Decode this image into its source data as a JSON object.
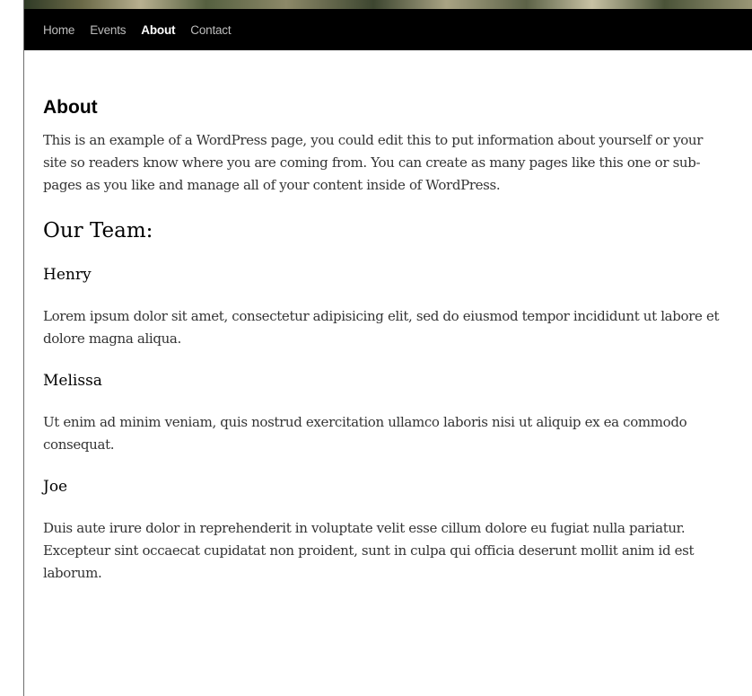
{
  "nav": {
    "items": [
      {
        "label": "Home",
        "active": false
      },
      {
        "label": "Events",
        "active": false
      },
      {
        "label": "About",
        "active": true
      },
      {
        "label": "Contact",
        "active": false
      }
    ]
  },
  "page": {
    "title": "About",
    "intro": "This is an example of a WordPress page, you could edit this to put information about yourself or your site so readers know where you are coming from. You can create as many pages like this one or sub-pages as you like and manage all of your content inside of WordPress.",
    "team_heading": "Our Team:",
    "team": [
      {
        "name": "Henry",
        "bio": "Lorem ipsum dolor sit amet, consectetur adipisicing elit, sed do eiusmod tempor incididunt ut labore et dolore magna aliqua."
      },
      {
        "name": "Melissa",
        "bio": "Ut enim ad minim veniam, quis nostrud exercitation ullamco laboris nisi ut aliquip ex ea commodo consequat."
      },
      {
        "name": "Joe",
        "bio": "Duis aute irure dolor in reprehenderit in voluptate velit esse cillum dolore eu fugiat nulla pariatur. Excepteur sint occaecat cupidatat non proident, sunt in culpa qui officia deserunt mollit anim id est laborum."
      }
    ]
  },
  "colors": {
    "nav_background": "#000000",
    "nav_text": "#bdbdbd",
    "nav_active_text": "#ffffff",
    "body_text": "#333333"
  }
}
